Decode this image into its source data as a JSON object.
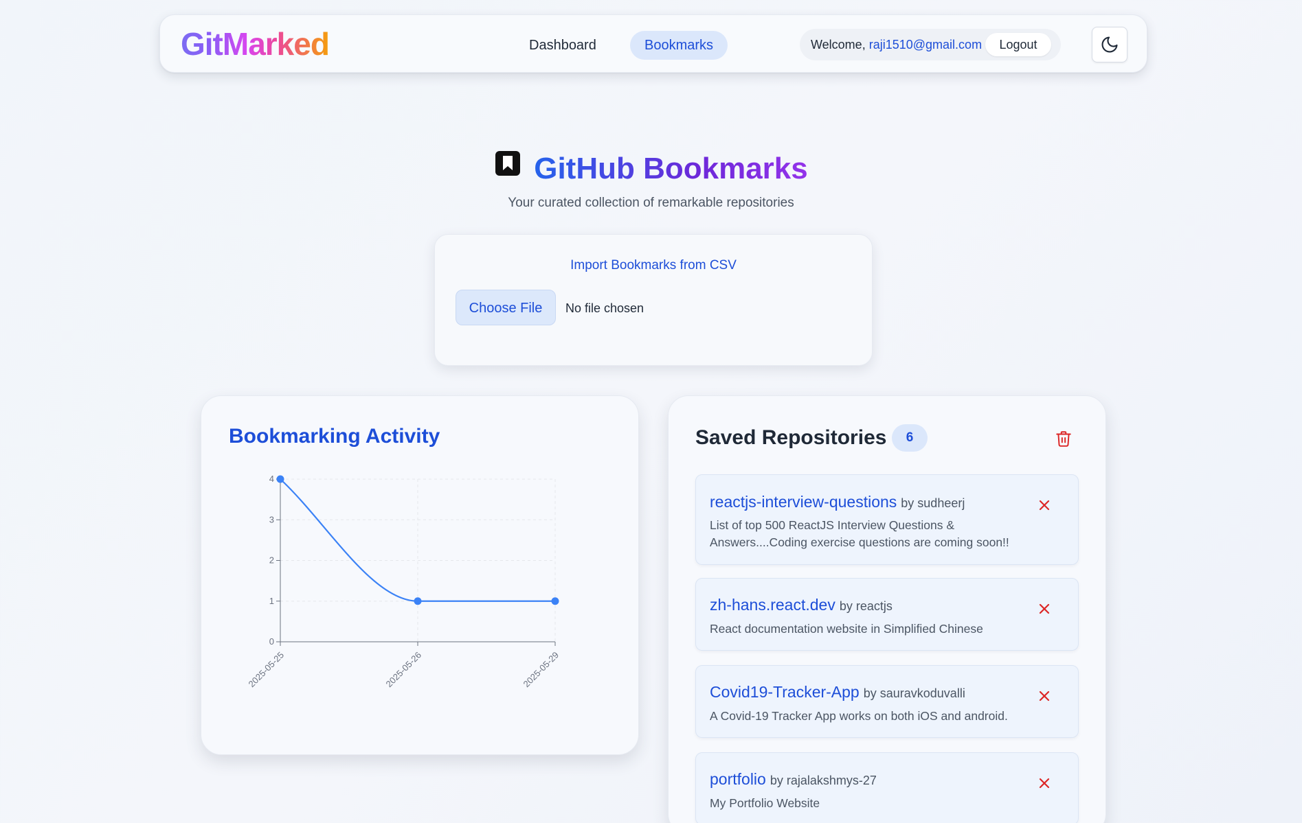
{
  "nav": {
    "logo": "GitMarked",
    "links": [
      {
        "label": "Dashboard",
        "active": false
      },
      {
        "label": "Bookmarks",
        "active": true
      }
    ],
    "welcome_prefix": "Welcome,",
    "user_email": "raji1510@gmail.com",
    "logout_label": "Logout",
    "theme_icon": "moon-icon"
  },
  "hero": {
    "icon": "bookmark-icon",
    "title": "GitHub Bookmarks",
    "subtitle": "Your curated collection of remarkable repositories"
  },
  "import": {
    "label": "Import Bookmarks from CSV",
    "button_label": "Choose File",
    "file_status": "No file chosen"
  },
  "activity": {
    "title": "Bookmarking Activity"
  },
  "chart_data": {
    "type": "line",
    "title": "Bookmarking Activity",
    "x": [
      "2025-05-25",
      "2025-05-26",
      "2025-05-29"
    ],
    "values": [
      4,
      1,
      1
    ],
    "yticks": [
      0,
      1,
      2,
      3,
      4
    ],
    "ylim": [
      0,
      4
    ],
    "grid": true,
    "color": "#3b82f6"
  },
  "saved": {
    "title": "Saved Repositories",
    "count": "6",
    "clear_icon": "trash-icon",
    "repos": [
      {
        "name": "reactjs-interview-questions",
        "owner": "by sudheerj",
        "description": "List of top 500 ReactJS Interview Questions & Answers....Coding exercise questions are coming soon!!"
      },
      {
        "name": "zh-hans.react.dev",
        "owner": "by reactjs",
        "description": "React documentation website in Simplified Chinese"
      },
      {
        "name": "Covid19-Tracker-App",
        "owner": "by sauravkoduvalli",
        "description": "A Covid-19 Tracker App works on both iOS and android."
      },
      {
        "name": "portfolio",
        "owner": "by rajalakshmys-27",
        "description": "My Portfolio Website"
      }
    ]
  },
  "colors": {
    "accent": "#1d4ed8",
    "danger": "#dc2626",
    "line": "#3b82f6"
  }
}
